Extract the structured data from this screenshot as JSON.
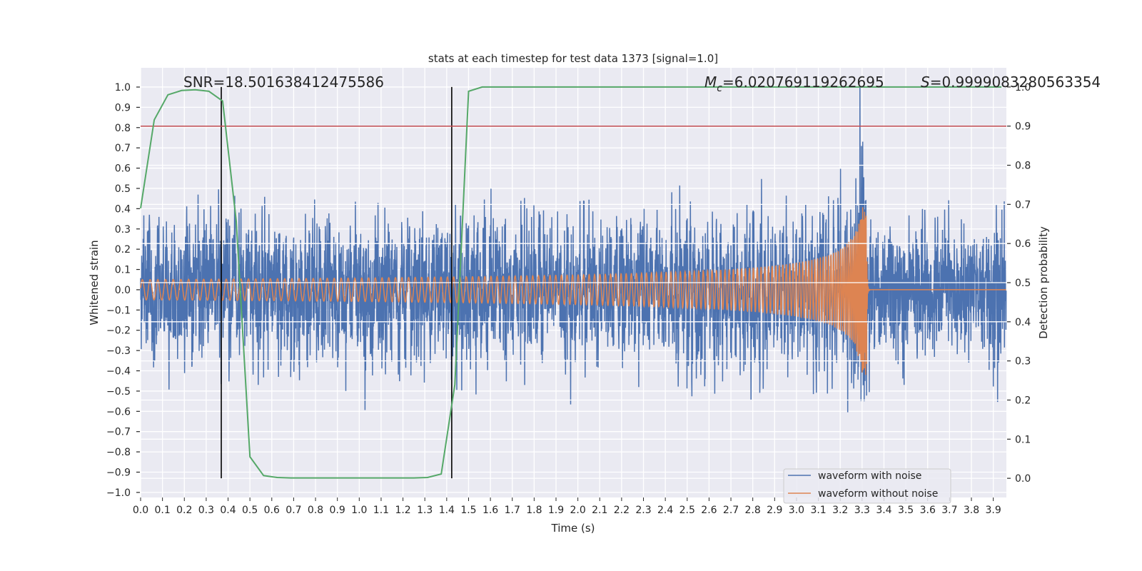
{
  "chart_data": {
    "type": "line",
    "title": "stats at each timestep for test data 1373 [signal=1.0]",
    "xlabel": "Time (s)",
    "ylabel": "Whitened strain",
    "ylabel_right": "Detection probability",
    "xlim": [
      0.0,
      3.96
    ],
    "ylim": [
      -1.025,
      1.095
    ],
    "ylim_right": [
      -0.049,
      1.049
    ],
    "grid": true,
    "background": "#eaeaf2",
    "x_ticks": [
      "0.0",
      "0.1",
      "0.2",
      "0.3",
      "0.4",
      "0.5",
      "0.6",
      "0.7",
      "0.8",
      "0.9",
      "1.0",
      "1.1",
      "1.2",
      "1.3",
      "1.4",
      "1.5",
      "1.6",
      "1.7",
      "1.8",
      "1.9",
      "2.0",
      "2.1",
      "2.2",
      "2.3",
      "2.4",
      "2.5",
      "2.6",
      "2.7",
      "2.8",
      "2.9",
      "3.0",
      "3.1",
      "3.2",
      "3.3",
      "3.4",
      "3.5",
      "3.6",
      "3.7",
      "3.8",
      "3.9"
    ],
    "y_ticks": [
      "1.0",
      "0.9",
      "0.8",
      "0.7",
      "0.6",
      "0.5",
      "0.4",
      "0.3",
      "0.2",
      "0.1",
      "0.0",
      "−0.1",
      "−0.2",
      "−0.3",
      "−0.4",
      "−0.5",
      "−0.6",
      "−0.7",
      "−0.8",
      "−0.9",
      "−1.0"
    ],
    "y_ticks_right": [
      "1.0",
      "0.9",
      "0.8",
      "0.7",
      "0.6",
      "0.5",
      "0.4",
      "0.3",
      "0.2",
      "0.1",
      "0.0"
    ],
    "annotations": {
      "snr": "SNR=18.501638412475586",
      "mc_symbol": "M",
      "mc_sub": "c",
      "mc_value": "=6.020769119262695",
      "s_symbol": "S",
      "s_value": "=0.9999083280563354"
    },
    "legend": {
      "placement": "lower-right",
      "entries": [
        "waveform with noise",
        "waveform without noise"
      ]
    },
    "series": [
      {
        "name": "waveform with noise",
        "axis": "left",
        "color": "#4c72b0",
        "description_values": {
          "noise_peak": 1.0,
          "peak_time": 3.29
        }
      },
      {
        "name": "waveform without noise",
        "axis": "left",
        "color": "#dd8452",
        "description_values": {
          "initial_amplitude": 0.05,
          "peak_amplitude": 0.42,
          "merger_time": 3.32
        }
      },
      {
        "axis": "right",
        "color": "#55a868",
        "x": [
          0,
          0.0625,
          0.125,
          0.1875,
          0.25,
          0.3125,
          0.375,
          0.4375,
          0.5,
          0.5625,
          0.625,
          0.6875,
          0.75,
          0.8125,
          0.875,
          0.9375,
          1.0,
          1.0625,
          1.125,
          1.1875,
          1.25,
          1.3125,
          1.375,
          1.4375,
          1.5,
          1.5625,
          1.625,
          1.6875,
          1.75,
          1.8125,
          1.875,
          1.9375,
          2.0,
          2.0625,
          2.125,
          2.1875,
          2.25,
          2.3125,
          2.375,
          2.4375,
          2.5,
          2.5625,
          2.625,
          2.6875,
          2.75,
          2.8125,
          2.875,
          2.9375,
          3.0,
          3.0625,
          3.125,
          3.1875,
          3.25,
          3.3125,
          3.375,
          3.4375,
          3.5,
          3.5625,
          3.625,
          3.6875,
          3.75,
          3.8125,
          3.875,
          3.9375
        ],
        "y": [
          0.69,
          0.916,
          0.98,
          0.991,
          0.993,
          0.989,
          0.964,
          0.657,
          0.055,
          0.007,
          0.002,
          0.001,
          0.001,
          0.001,
          0.001,
          0.001,
          0.001,
          0.001,
          0.001,
          0.001,
          0.001,
          0.002,
          0.011,
          0.24,
          0.989,
          1.0,
          1.0,
          1.0,
          1.0,
          1.0,
          1.0,
          1.0,
          1.0,
          1.0,
          1.0,
          1.0,
          1.0,
          1.0,
          1.0,
          1.0,
          1.0,
          1.0,
          1.0,
          1.0,
          1.0,
          1.0,
          1.0,
          1.0,
          1.0,
          1.0,
          1.0,
          1.0,
          1.0,
          1.0,
          1.0,
          1.0,
          1.0,
          1.0,
          1.0,
          1.0,
          1.0,
          1.0,
          1.0,
          1.0
        ]
      }
    ],
    "threshold_line": {
      "axis": "right",
      "value": 0.9,
      "color": "#c44e52"
    },
    "vertical_lines": {
      "x": [
        0.369,
        1.423
      ],
      "range_right": [
        0.0,
        1.0
      ],
      "color": "#000000"
    }
  }
}
